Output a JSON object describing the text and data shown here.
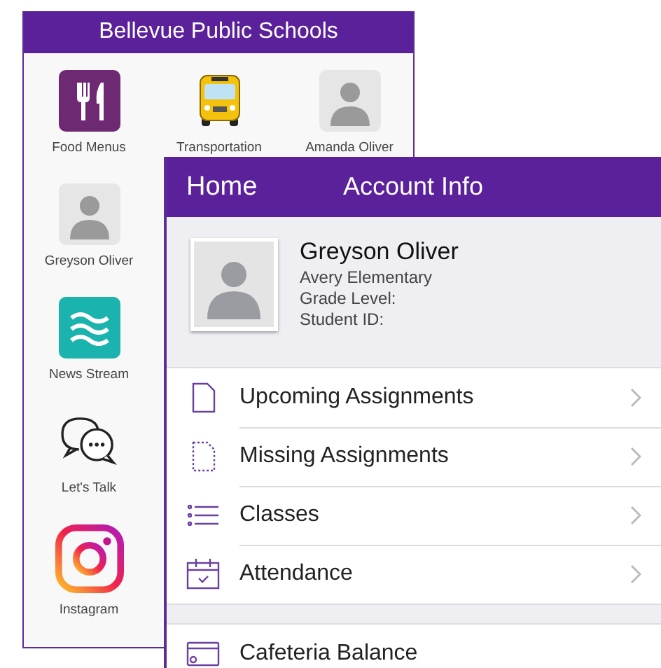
{
  "back_screen": {
    "title": "Bellevue Public Schools",
    "tiles": [
      {
        "kind": "food",
        "label": "Food Menus"
      },
      {
        "kind": "bus",
        "label": "Transportation"
      },
      {
        "kind": "person",
        "label": "Amanda Oliver"
      },
      {
        "kind": "person",
        "label": "Greyson Oliver"
      },
      {
        "kind": "waves",
        "label": "News Stream"
      },
      {
        "kind": "chat",
        "label": "Let's Talk"
      },
      {
        "kind": "instagram",
        "label": "Instagram"
      }
    ]
  },
  "front_screen": {
    "back_label": "Home",
    "title": "Account Info",
    "profile": {
      "name": "Greyson Oliver",
      "school": "Avery Elementary",
      "grade": "Grade Level:",
      "student_id": "Student ID:"
    },
    "menu_sections": [
      {
        "items": [
          {
            "kind": "upcoming",
            "label": "Upcoming Assignments",
            "chevron": true
          },
          {
            "kind": "missing",
            "label": "Missing Assignments",
            "chevron": true
          },
          {
            "kind": "classes",
            "label": "Classes",
            "chevron": true
          },
          {
            "kind": "attendance",
            "label": "Attendance",
            "chevron": true
          }
        ]
      },
      {
        "items": [
          {
            "kind": "cafeteria",
            "label": "Cafeteria Balance",
            "chevron": false
          }
        ]
      }
    ]
  }
}
